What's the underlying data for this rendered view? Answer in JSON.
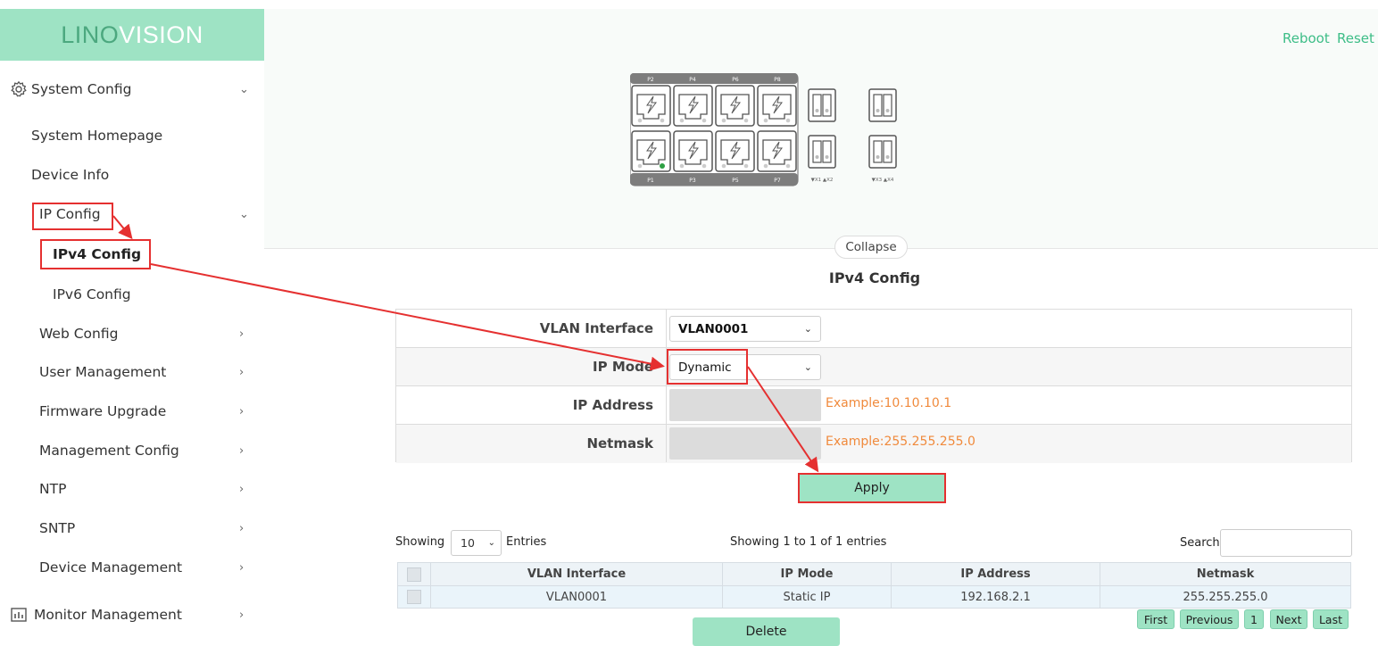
{
  "brand": {
    "part1": "LINO",
    "part2": "VISION"
  },
  "top_links": {
    "reboot": "Reboot",
    "reset": "Reset"
  },
  "sidebar": {
    "system_config": "System Config",
    "system_homepage": "System Homepage",
    "device_info": "Device Info",
    "ip_config": "IP Config",
    "ipv4_config": "IPv4 Config",
    "ipv6_config": "IPv6 Config",
    "web_config": "Web Config",
    "user_management": "User Management",
    "firmware_upgrade": "Firmware Upgrade",
    "management_config": "Management Config",
    "ntp": "NTP",
    "sntp": "SNTP",
    "device_management": "Device Management",
    "monitor_management": "Monitor Management"
  },
  "ports": {
    "top_labels": [
      "P2",
      "P4",
      "P6",
      "P8"
    ],
    "bottom_labels": [
      "P1",
      "P3",
      "P5",
      "P7"
    ],
    "sfp_label_1": "▼X1 ▲X2",
    "sfp_label_2": "▼X3 ▲X4",
    "link_color": "#2ea043"
  },
  "collapse_label": "Collapse",
  "page_title": "IPv4 Config",
  "form": {
    "vlan_label": "VLAN Interface",
    "vlan_value": "VLAN0001",
    "ip_mode_label": "IP Mode",
    "ip_mode_value": "Dynamic",
    "ip_address_label": "IP Address",
    "ip_address_example": "Example:10.10.10.1",
    "netmask_label": "Netmask",
    "netmask_example": "Example:255.255.255.0"
  },
  "apply_label": "Apply",
  "table": {
    "showing_label": "Showing",
    "page_length": "10",
    "entries_label": "Entries",
    "info": "Showing 1 to 1 of 1 entries",
    "search_label": "Search",
    "columns": [
      "VLAN Interface",
      "IP Mode",
      "IP Address",
      "Netmask"
    ],
    "rows": [
      {
        "vlan": "VLAN0001",
        "mode": "Static IP",
        "ip": "192.168.2.1",
        "mask": "255.255.255.0"
      }
    ]
  },
  "pagination": {
    "first": "First",
    "previous": "Previous",
    "page": "1",
    "next": "Next",
    "last": "Last"
  },
  "delete_label": "Delete",
  "colors": {
    "accent": "#9ee3c4",
    "accent_text": "#3dbd87",
    "highlight": "#e53030",
    "example_text": "#f08a3c"
  }
}
